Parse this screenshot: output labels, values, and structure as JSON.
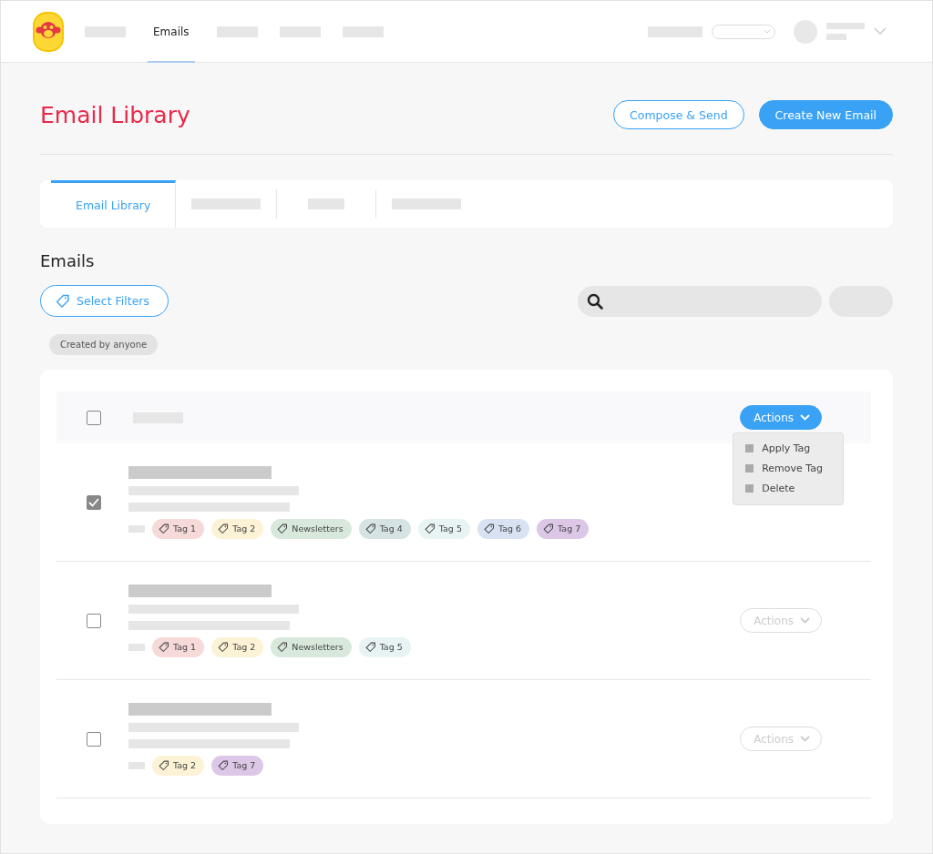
{
  "nav": [
    {
      "label": "Emails",
      "selected": true
    }
  ],
  "page": {
    "title": "Email Library",
    "buttons": [
      {
        "label": "Compose & Send",
        "kind": "outline"
      },
      {
        "label": "Create New Email",
        "kind": "primary"
      }
    ]
  },
  "tabs": [
    {
      "label": "Email Library",
      "selected": true
    }
  ],
  "section_title": "Emails",
  "filters": {
    "button": "Select Filters",
    "chips": [
      "Created by anyone"
    ]
  },
  "list": {
    "header": {
      "checked": false,
      "actions": {
        "label": "Actions",
        "disabled": false,
        "expanded": true,
        "menu": [
          "Apply Tag",
          "Remove Tag",
          "Delete"
        ]
      }
    },
    "rows": [
      {
        "checked": true,
        "tags": [
          {
            "label": "Tag 1",
            "color": "#f6d9d9"
          },
          {
            "label": "Tag 2",
            "color": "#fcf3d6"
          },
          {
            "label": "Newsletters",
            "color": "#d8e9dc"
          },
          {
            "label": "Tag 4",
            "color": "#d6e3e3"
          },
          {
            "label": "Tag 5",
            "color": "#e8f4f4"
          },
          {
            "label": "Tag 6",
            "color": "#d9e2f3"
          },
          {
            "label": "Tag 7",
            "color": "#dcc8e6"
          }
        ]
      },
      {
        "checked": false,
        "actions": {
          "label": "Actions",
          "disabled": true
        },
        "tags": [
          {
            "label": "Tag 1",
            "color": "#f6d9d9"
          },
          {
            "label": "Tag 2",
            "color": "#fcf3d6"
          },
          {
            "label": "Newsletters",
            "color": "#d8e9dc"
          },
          {
            "label": "Tag 5",
            "color": "#e8f4f4"
          }
        ]
      },
      {
        "checked": false,
        "actions": {
          "label": "Actions",
          "disabled": true
        },
        "tags": [
          {
            "label": "Tag 2",
            "color": "#fcf3d6"
          },
          {
            "label": "Tag 7",
            "color": "#dcc8e6"
          }
        ]
      }
    ]
  }
}
